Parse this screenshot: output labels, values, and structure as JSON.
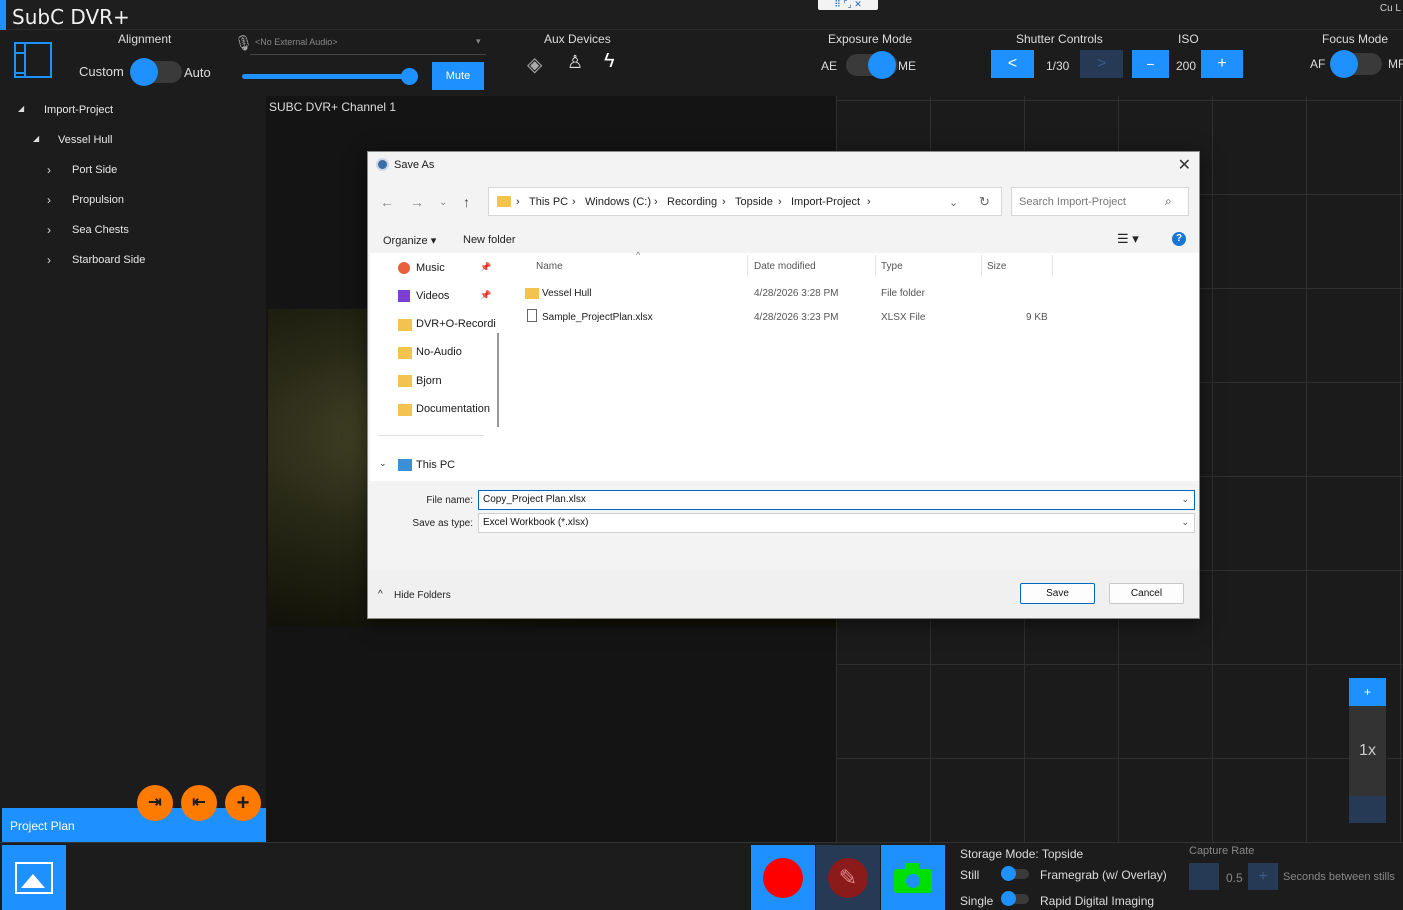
{
  "app": {
    "title": "SubC DVR+",
    "corner_text": "Cu L"
  },
  "toolbar": {
    "alignment_label": "Alignment",
    "alignment_left": "Custom",
    "alignment_right": "Auto",
    "audio_placeholder": "<No External Audio>",
    "mute_label": "Mute",
    "aux_label": "Aux Devices",
    "exposure_label": "Exposure Mode",
    "exposure_left": "AE",
    "exposure_right": "ME",
    "shutter_label": "Shutter Controls",
    "shutter_prev": "<",
    "shutter_value": "1/30",
    "shutter_next": ">",
    "iso_label": "ISO",
    "iso_minus": "−",
    "iso_value": "200",
    "iso_plus": "+",
    "focus_label": "Focus Mode",
    "focus_left": "AF",
    "focus_right": "MF"
  },
  "tree": {
    "items": [
      {
        "label": "Import-Project",
        "arrow": "◢"
      },
      {
        "label": "Vessel Hull",
        "arrow": "◢"
      },
      {
        "label": "Port Side",
        "arrow": "›"
      },
      {
        "label": "Propulsion",
        "arrow": "›"
      },
      {
        "label": "Sea Chests",
        "arrow": "›"
      },
      {
        "label": "Starboard Side",
        "arrow": "›"
      }
    ],
    "project_label": "Project Plan"
  },
  "fabs": {
    "import_icon": "⇥",
    "export_icon": "⇤",
    "add_icon": "+"
  },
  "video": {
    "channel_title": "SUBC DVR+ Channel 1"
  },
  "zoom": {
    "plus": "+",
    "level": "1x"
  },
  "bottom": {
    "storage_mode": "Storage Mode: Topside",
    "still_label": "Still",
    "framegrab_label": "Framegrab (w/ Overlay)",
    "single_label": "Single",
    "rdi_label": "Rapid Digital Imaging",
    "capture_rate_label": "Capture Rate",
    "capture_rate_value": "0.5",
    "capture_rate_unit": "Seconds between stills"
  },
  "dialog": {
    "title": "Save As",
    "close": "✕",
    "path": [
      "This PC",
      "Windows (C:)",
      "Recording",
      "Topside",
      "Import-Project"
    ],
    "search_placeholder": "Search Import-Project",
    "organize": "Organize ▾",
    "new_folder": "New folder",
    "help": "?",
    "nav_items": [
      {
        "label": "Music",
        "icon": "music-icon",
        "pinned": true
      },
      {
        "label": "Videos",
        "icon": "video-icon",
        "pinned": true
      },
      {
        "label": "DVR+O-Recordi",
        "icon": "folder-icon",
        "pinned": false
      },
      {
        "label": "No-Audio",
        "icon": "folder-icon",
        "pinned": false
      },
      {
        "label": "Bjorn",
        "icon": "folder-icon",
        "pinned": false
      },
      {
        "label": "Documentation",
        "icon": "folder-icon",
        "pinned": false
      }
    ],
    "this_pc": "This PC",
    "columns": {
      "name": "Name",
      "date": "Date modified",
      "type": "Type",
      "size": "Size"
    },
    "files": [
      {
        "name": "Vessel Hull",
        "date": "4/28/2026 3:28 PM",
        "type": "File folder",
        "size": "",
        "icon": "folder-icon"
      },
      {
        "name": "Sample_ProjectPlan.xlsx",
        "date": "4/28/2026 3:23 PM",
        "type": "XLSX File",
        "size": "9 KB",
        "icon": "file-icon"
      }
    ],
    "file_name_label": "File name:",
    "file_name_value": "Copy_Project Plan.xlsx",
    "save_type_label": "Save as type:",
    "save_type_value": "Excel Workbook (*.xlsx)",
    "hide_folders": "Hide Folders",
    "save": "Save",
    "cancel": "Cancel"
  }
}
